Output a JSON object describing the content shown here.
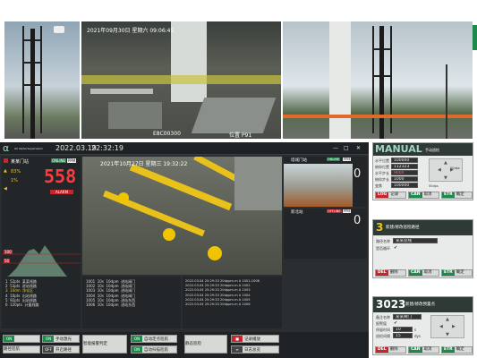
{
  "cameras_top": {
    "cam1": {
      "desc": ""
    },
    "cam2": {
      "timestamp": "2021年09月30日 星期六 09:06:45",
      "code": "E8C00300",
      "label": "位置 P91"
    },
    "cam3": {
      "desc": ""
    }
  },
  "app": {
    "logo": "α",
    "logo_sub": "AC Alpha Supervision",
    "date": "2022.03.19",
    "time": "22:32:19",
    "window_buttons": [
      "—",
      "□",
      "✕"
    ]
  },
  "left_panel": {
    "station_label": "某某门站",
    "status_online": "ONLINE",
    "status_ppm": "PPM",
    "level_value": "558",
    "level_alarm": "ALARM",
    "ind1": "83%",
    "ind2": "1%",
    "chart_ticks": [
      "100",
      "50"
    ],
    "list": [
      {
        "id": "1",
        "value": "52pts",
        "name": "某某线路"
      },
      {
        "id": "2",
        "value": "53pts",
        "name": "进站线路"
      },
      {
        "id": "3",
        "value": "10dm",
        "name": "净化区"
      },
      {
        "id": "4",
        "value": "10pts",
        "name": "出站线路"
      },
      {
        "id": "5",
        "value": "92pts",
        "name": "出站线路"
      },
      {
        "id": "6",
        "value": "120pts",
        "name": "计量线路"
      }
    ]
  },
  "center_video": {
    "timestamp": "2021年10月27日 星期三 19:32:22"
  },
  "right_feeds": [
    {
      "name": "塔城门站",
      "online": "ONLINE",
      "ppm": "PPM",
      "value": "0"
    },
    {
      "name": "新北站",
      "online": "OFFLINE",
      "ppm": "PPM",
      "value": "0"
    }
  ],
  "mid_list": [
    {
      "id": "1001",
      "v": "10s",
      "s": "10dpm",
      "name": "进站阀门"
    },
    {
      "id": "1002",
      "v": "10s",
      "s": "10dpm",
      "name": "进站阀门"
    },
    {
      "id": "1003",
      "v": "10s",
      "s": "10dpm",
      "name": "进站阀门"
    },
    {
      "id": "1004",
      "v": "10s",
      "s": "10dpm",
      "name": "进站阀门"
    },
    {
      "id": "1005",
      "v": "10s",
      "s": "10dpm",
      "name": "进站东西"
    },
    {
      "id": "1006",
      "v": "10s",
      "s": "10dpm",
      "name": "进站东西"
    }
  ],
  "log_list": [
    {
      "t": "2022.03.04  25:29:33",
      "v": "20dppm.m",
      "a": "A",
      "id": "1001-1006"
    },
    {
      "t": "2022.03.04  25:29:33",
      "v": "20dppm.m",
      "a": "A",
      "id": "1002"
    },
    {
      "t": "2022.03.04  25:29:33",
      "v": "20dppm.m",
      "a": "A",
      "id": "1003"
    },
    {
      "t": "2022.03.04  25:29:33",
      "v": "20dppm.m",
      "a": "A",
      "id": "1004"
    },
    {
      "t": "2022.03.04  25:29:33",
      "v": "20dppm.m",
      "a": "A",
      "id": "1005"
    },
    {
      "t": "2022.03.04  25:29:33",
      "v": "20dppm.m",
      "a": "A",
      "id": "1006"
    }
  ],
  "bottom_bar": {
    "row1": [
      "路径巡航",
      "手动激光",
      "智能报警判定",
      "自动定点巡航",
      "自动扫描巡航",
      "静态巡检",
      "记录播放"
    ],
    "row2": [
      "日志总览",
      "开启路径"
    ],
    "tags": [
      "ON",
      "OFF",
      "ON",
      "ON",
      "ON"
    ]
  },
  "manual_panel": {
    "title": "MANUAL",
    "subtitle": "手动巡检",
    "rows": [
      {
        "label": "水平位置",
        "value": "100000"
      },
      {
        "label": "俯仰位置",
        "value": "112323"
      },
      {
        "label": "水平步长",
        "value": "9000"
      },
      {
        "label": "俯仰步长",
        "value": "1000"
      },
      {
        "label": "变焦",
        "value": "100000"
      }
    ],
    "speed_labels": [
      "50dps",
      "50dps"
    ],
    "buttons": [
      {
        "key": "LOG",
        "label": "记录",
        "color": "#c4262b"
      },
      {
        "key": "CAN",
        "label": "取消",
        "color": "#1d8a4b"
      },
      {
        "key": "ETR",
        "label": "确定",
        "color": "#1d8a4b"
      }
    ]
  },
  "path_panel": {
    "number": "3",
    "title": "新建/修改巡检路径",
    "label1": "路径名称",
    "value1": "某某巡线",
    "label2": "是否循环",
    "check": "✔",
    "buttons": [
      {
        "key": "DEL",
        "label": "删除",
        "color": "#c4262b"
      },
      {
        "key": "CAN",
        "label": "取消",
        "color": "#1d8a4b"
      },
      {
        "key": "ETR",
        "label": "确定",
        "color": "#1d8a4b"
      }
    ]
  },
  "preset_panel": {
    "number": "3023",
    "title": "新建/修改预置点",
    "rows": [
      {
        "label": "备注名称",
        "value": "某某阀门"
      },
      {
        "label": "报警值",
        "value": "✔"
      },
      {
        "label": "停留时间",
        "value": "10"
      },
      {
        "label": "巡检间隔",
        "value": "15"
      }
    ],
    "units": [
      "s",
      "dys"
    ],
    "buttons": [
      {
        "key": "DEL",
        "label": "删除",
        "color": "#c4262b"
      },
      {
        "key": "CAN",
        "label": "取消",
        "color": "#1d8a4b"
      },
      {
        "key": "ETR",
        "label": "确定",
        "color": "#1d8a4b"
      }
    ]
  },
  "colors": {
    "alarm_red": "#c4262b",
    "ok_green": "#1d8a4b",
    "accent_yellow": "#e8c21a",
    "panel_dark": "#2f3a36"
  }
}
